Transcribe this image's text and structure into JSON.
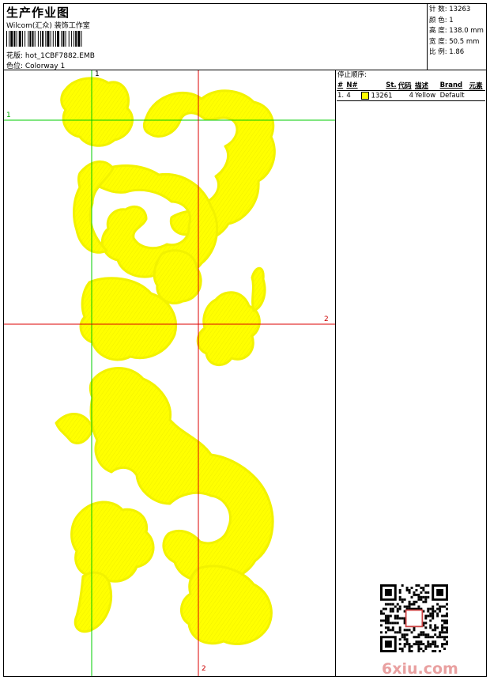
{
  "header": {
    "title": "生产作业图",
    "subtitle": "Wilcom(汇众) 装饰工作室",
    "pattern_label": "花版: hot_1CBF7882.EMB",
    "colorway_label": "色位:  Colorway 1"
  },
  "stats": {
    "stitches": "针 数: 13263",
    "colors": "颜 色: 1",
    "height": "高 度: 138.0 mm",
    "width": "宽 度: 50.5 mm",
    "ratio": "比 例: 1.86"
  },
  "guides": {
    "v1_top": "1",
    "h1_left": "1",
    "h2_right": "2",
    "v2_bottom": "2"
  },
  "stop_sequence": {
    "title": "停止顺序:",
    "columns": [
      "#",
      "N#",
      "St.",
      "代码",
      "描述",
      "Brand",
      "元素"
    ],
    "rows": [
      {
        "num": "1.",
        "needle": "4",
        "code": "13261",
        "stitches_col": "4",
        "desc": "Yellow",
        "brand": "Default",
        "element": "",
        "color": "#ffff00"
      }
    ]
  },
  "watermark": "6xiu.com",
  "colors": {
    "thread": "#ffff00",
    "thread_stroke": "#e8e800",
    "guide_green": "#00cc00",
    "guide_red": "#dd0000",
    "watermark": "#e9a0a0"
  }
}
